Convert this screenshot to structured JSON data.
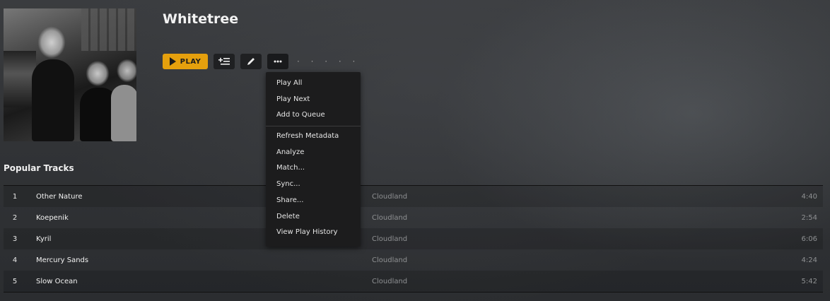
{
  "album": {
    "title": "Whitetree",
    "cover_alt": "Album cover photo"
  },
  "toolbar": {
    "play_label": "PLAY",
    "icons": [
      "play-icon",
      "add-to-playlist-icon",
      "edit-pencil-icon",
      "more-options-icon"
    ],
    "progress_dots": "· · · · ·"
  },
  "menu": {
    "items_group1": [
      {
        "label": "Play All"
      },
      {
        "label": "Play Next"
      },
      {
        "label": "Add to Queue"
      }
    ],
    "items_group2": [
      {
        "label": "Refresh Metadata"
      },
      {
        "label": "Analyze"
      },
      {
        "label": "Match..."
      },
      {
        "label": "Sync..."
      },
      {
        "label": "Share..."
      },
      {
        "label": "Delete"
      },
      {
        "label": "View Play History"
      }
    ]
  },
  "popular": {
    "title": "Popular Tracks",
    "tracks": [
      {
        "num": "1",
        "name": "Other Nature",
        "album": "Cloudland",
        "duration": "4:40"
      },
      {
        "num": "2",
        "name": "Koepenik",
        "album": "Cloudland",
        "duration": "2:54"
      },
      {
        "num": "3",
        "name": "Kyril",
        "album": "Cloudland",
        "duration": "6:06"
      },
      {
        "num": "4",
        "name": "Mercury Sands",
        "album": "Cloudland",
        "duration": "4:24"
      },
      {
        "num": "5",
        "name": "Slow Ocean",
        "album": "Cloudland",
        "duration": "5:42"
      }
    ]
  },
  "colors": {
    "accent": "#e5a00d",
    "menu_bg": "#1c1c1d",
    "muted_text": "#8e9092"
  }
}
